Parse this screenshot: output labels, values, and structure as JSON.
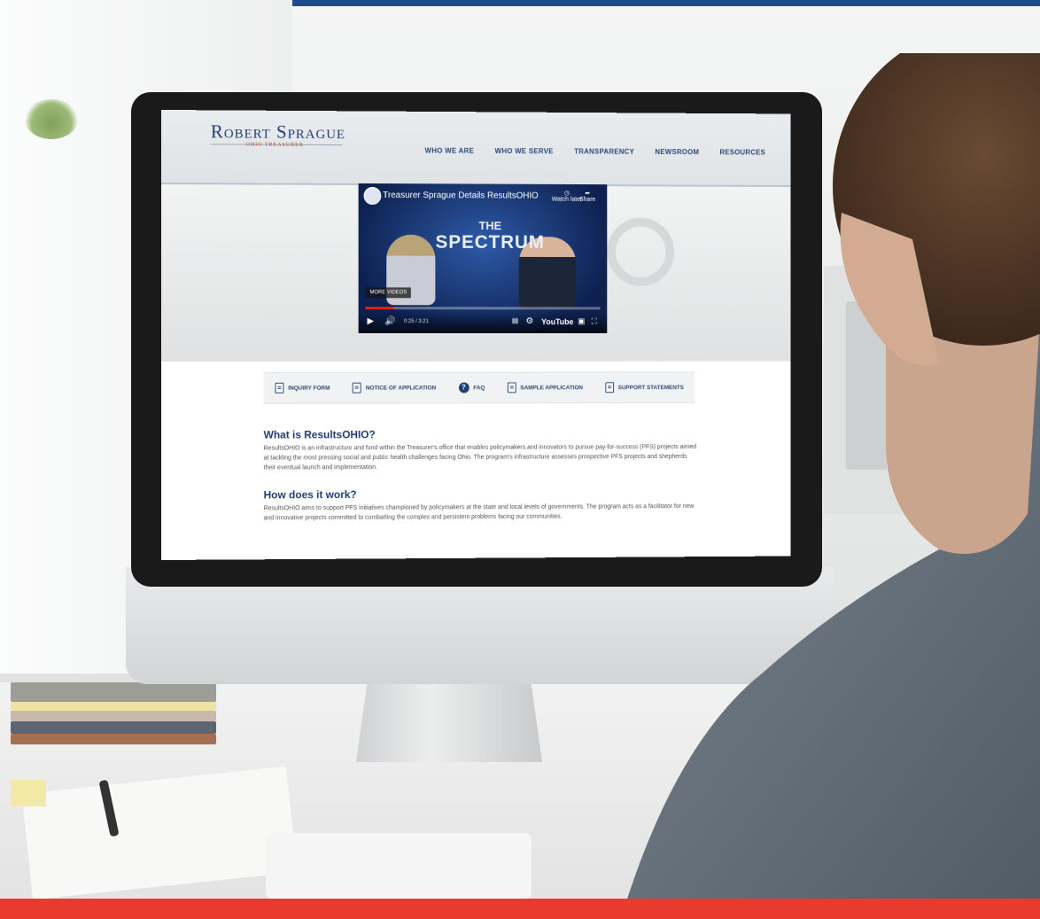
{
  "colors": {
    "top_band": "#1d4c8c",
    "bottom_band": "#ea3a2e",
    "brand_blue": "#1f3d73"
  },
  "site": {
    "logo": "Robert Sprague",
    "logo_sub": "OHIO TREASURER",
    "nav": [
      "WHO WE ARE",
      "WHO WE SERVE",
      "TRANSPARENCY",
      "NEWSROOM",
      "RESOURCES"
    ]
  },
  "video": {
    "title": "Treasurer Sprague Details ResultsOHIO",
    "the": "THE",
    "show": "SPECTRUM",
    "watch_later": "Watch later",
    "share": "Share",
    "more_videos": "MORE VIDEOS",
    "time": "0:25 / 3:21",
    "brand": "YouTube",
    "progress": 0.12
  },
  "links": [
    {
      "label": "INQUIRY FORM",
      "icon": "document-icon"
    },
    {
      "label": "NOTICE OF APPLICATION",
      "icon": "document-icon"
    },
    {
      "label": "FAQ",
      "icon": "faq-icon"
    },
    {
      "label": "SAMPLE APPLICATION",
      "icon": "document-icon"
    },
    {
      "label": "SUPPORT STATEMENTS",
      "icon": "document-icon"
    }
  ],
  "content": {
    "h1": "What is ResultsOHIO?",
    "p1": "ResultsOHIO is an infrastructure and fund within the Treasurer's office that enables policymakers and innovators to pursue pay-for-success (PFS) projects aimed at tackling the most pressing social and public health challenges facing Ohio. The program's infrastructure assesses prospective PFS projects and shepherds their eventual launch and implementation.",
    "h2": "How does it work?",
    "p2": "ResultsOHIO aims to support PFS initiatives championed by policymakers at the state and local levels of governments. The program acts as a facilitator for new and innovative projects committed to combatting the complex and persistent problems facing our communities."
  }
}
